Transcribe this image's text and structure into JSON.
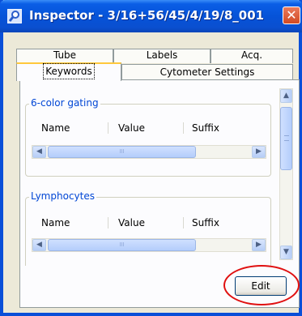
{
  "window": {
    "title": "Inspector - 3/16+56/45/4/19/8_001",
    "close_glyph": "✕",
    "title_icon": "magnifier-icon"
  },
  "tabs": {
    "back_row": [
      "Tube",
      "Labels",
      "Acq."
    ],
    "front_row": [
      "Keywords",
      "Cytometer Settings"
    ],
    "active": "Keywords"
  },
  "groups": [
    {
      "title": "6-color gating",
      "columns": [
        "Name",
        "Value",
        "Suffix"
      ]
    },
    {
      "title": "Lymphocytes",
      "columns": [
        "Name",
        "Value",
        "Suffix"
      ]
    }
  ],
  "scroll": {
    "left_arrow": "◀",
    "right_arrow": "▶",
    "up_arrow": "▲",
    "down_arrow": "▼",
    "thumb_grip": "III"
  },
  "actions": {
    "edit_label": "Edit"
  },
  "colors": {
    "titlebar": "#0653d8",
    "group_title": "#0046d5",
    "annotation": "#e01010"
  }
}
